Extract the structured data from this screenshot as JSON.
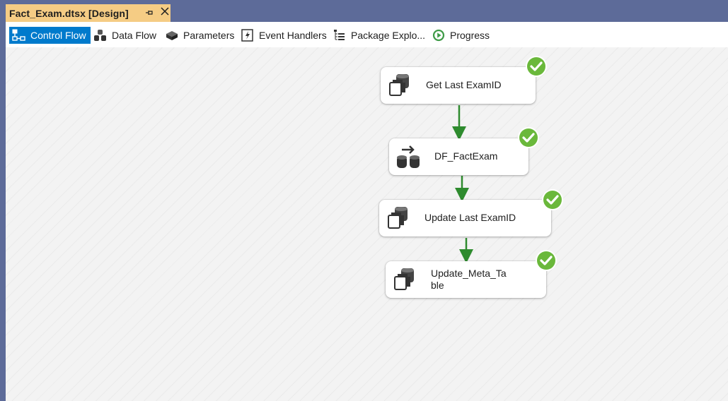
{
  "document_tab": {
    "title": "Fact_Exam.dtsx [Design]",
    "pin_icon": "pin-icon",
    "close_icon": "close-icon"
  },
  "toolbar": {
    "tabs": [
      {
        "label": "Control Flow",
        "icon": "control-flow-icon",
        "active": true
      },
      {
        "label": "Data Flow",
        "icon": "data-flow-icon",
        "active": false
      },
      {
        "label": "Parameters",
        "icon": "parameters-icon",
        "active": false
      },
      {
        "label": "Event Handlers",
        "icon": "event-handlers-icon",
        "active": false
      },
      {
        "label": "Package Explo...",
        "icon": "package-explorer-icon",
        "active": false
      },
      {
        "label": "Progress",
        "icon": "progress-icon",
        "active": false
      }
    ]
  },
  "tasks": [
    {
      "label": "Get Last ExamID",
      "icon": "execute-sql-task-icon",
      "status": "success"
    },
    {
      "label": "DF_FactExam",
      "icon": "data-flow-task-icon",
      "status": "success"
    },
    {
      "label": "Update Last ExamID",
      "icon": "execute-sql-task-icon",
      "status": "success"
    },
    {
      "label_line1": "Update_Meta_Ta",
      "label_line2": "ble",
      "icon": "execute-sql-task-icon",
      "status": "success"
    }
  ],
  "colors": {
    "accent": "#007acc",
    "tab_highlight": "#f5cc84",
    "frame": "#5d6b99",
    "success_green": "#6ab83b",
    "connector_green": "#2e8b2e"
  }
}
